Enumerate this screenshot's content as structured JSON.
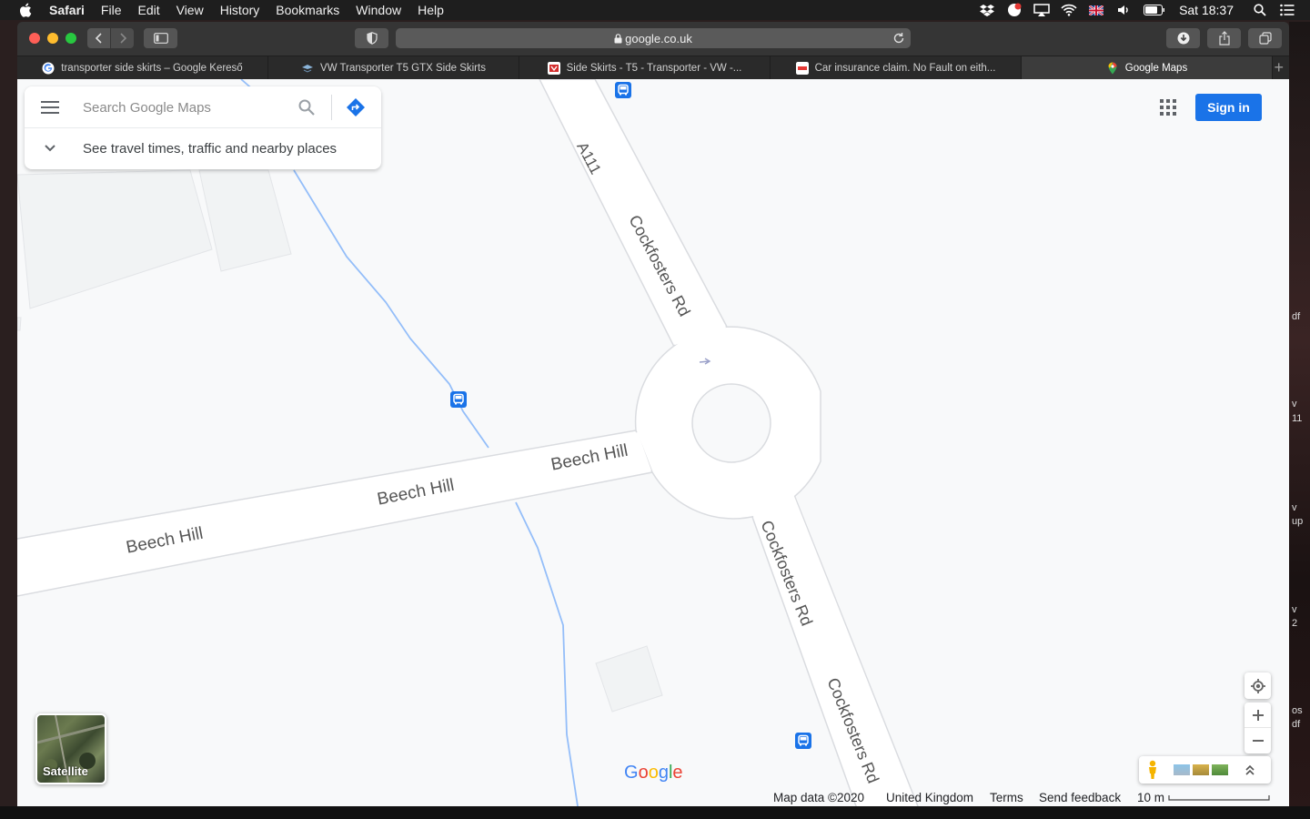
{
  "menubar": {
    "app": "Safari",
    "items": [
      "File",
      "Edit",
      "View",
      "History",
      "Bookmarks",
      "Window",
      "Help"
    ],
    "clock": "Sat 18:37"
  },
  "browser": {
    "url": "google.co.uk",
    "tabs": [
      {
        "title": "transporter side skirts – Google Kereső",
        "icon": "google-icon"
      },
      {
        "title": "VW Transporter T5 GTX Side Skirts",
        "icon": "vw-site-icon"
      },
      {
        "title": "Side Skirts - T5 - Transporter - VW -...",
        "icon": "site-icon"
      },
      {
        "title": "Car insurance claim. No Fault on eith...",
        "icon": "hse-icon"
      },
      {
        "title": "Google Maps",
        "icon": "google-maps-icon"
      }
    ]
  },
  "maps": {
    "search_placeholder": "Search Google Maps",
    "travel_times": "See travel times, traffic and nearby places",
    "sign_in": "Sign in",
    "satellite_label": "Satellite",
    "roads": {
      "a111": "A111",
      "cockfosters_north": "Cockfosters Rd",
      "cockfosters_south_1": "Cockfosters Rd",
      "cockfosters_south_2": "Cockfosters Rd",
      "beech_hill_1": "Beech Hill",
      "beech_hill_2": "Beech Hill",
      "beech_hill_3": "Beech Hill"
    },
    "logo": "Google",
    "footer": {
      "map_data": "Map data ©2020",
      "region": "United Kingdom",
      "terms": "Terms",
      "feedback": "Send feedback",
      "scale": "10 m"
    }
  },
  "desktop_fragments": [
    "df",
    "v",
    "11",
    "v",
    "up",
    "v",
    "2",
    "os",
    "df"
  ]
}
